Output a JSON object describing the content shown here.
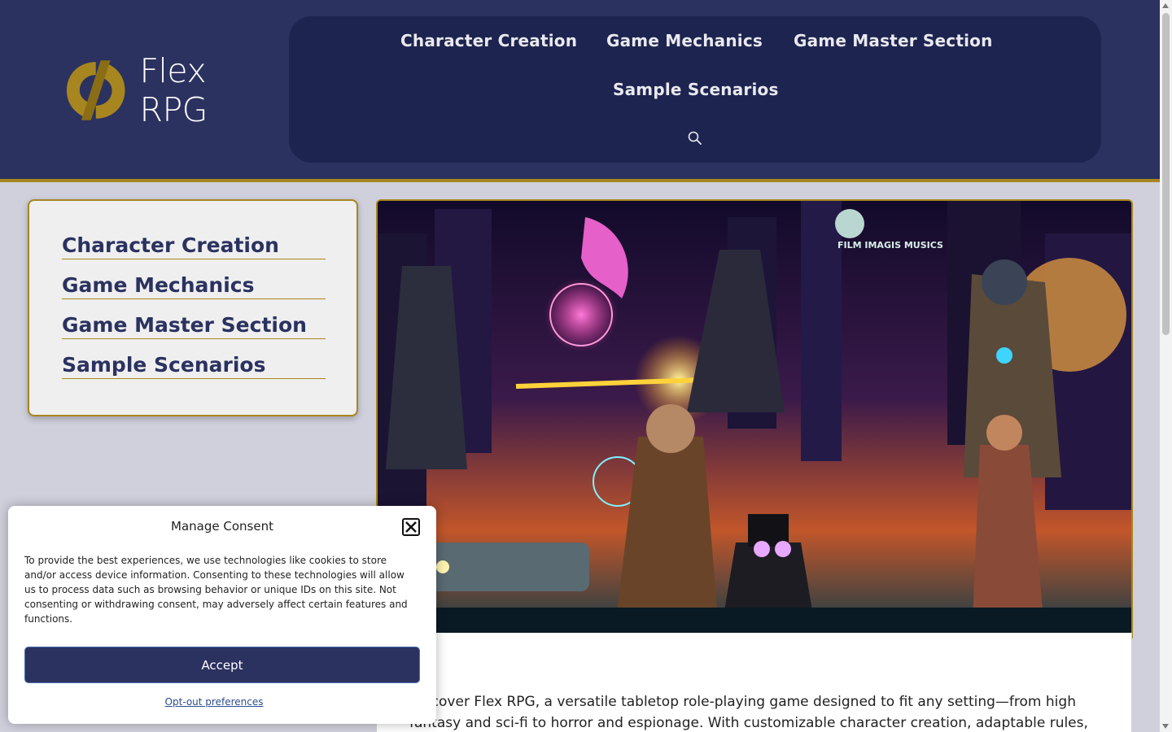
{
  "site": {
    "logo_text": "Flex RPG",
    "brand_dark": "#2b3260",
    "brand_gold": "#a8861f"
  },
  "nav": {
    "items": [
      {
        "label": "Character Creation"
      },
      {
        "label": "Game Mechanics"
      },
      {
        "label": "Game Master Section"
      },
      {
        "label": "Sample Scenarios"
      }
    ],
    "search_icon": "search-icon"
  },
  "sidebar": {
    "items": [
      {
        "label": "Character Creation"
      },
      {
        "label": "Game Mechanics"
      },
      {
        "label": "Game Master Section"
      },
      {
        "label": "Sample Scenarios"
      }
    ]
  },
  "hero": {
    "sign_text": "FILM IMAGIS MUSICS"
  },
  "content": {
    "intro": "Discover Flex RPG, a versatile tabletop role-playing game designed to fit any setting—from high fantasy and sci-fi to horror and espionage. With customizable character creation, adaptable rules,"
  },
  "consent": {
    "title": "Manage Consent",
    "body": "To provide the best experiences, we use technologies like cookies to store and/or access device information. Consenting to these technologies will allow us to process data such as browsing behavior or unique IDs on this site. Not consenting or withdrawing consent, may adversely affect certain features and functions.",
    "accept_label": "Accept",
    "optout_label": "Opt-out preferences",
    "close_icon": "close-icon"
  }
}
